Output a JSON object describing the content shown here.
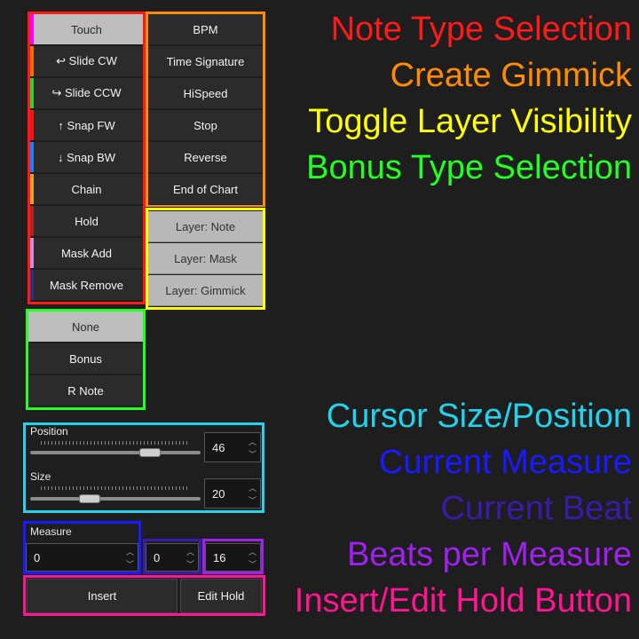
{
  "note_types": [
    {
      "label": "Touch",
      "stripe": "#ff00ff",
      "selected": true
    },
    {
      "label": "↩ Slide CW",
      "stripe": "#ff6a00",
      "selected": false
    },
    {
      "label": "↪ Slide CCW",
      "stripe": "#2fd12f",
      "selected": false
    },
    {
      "label": "↑ Snap FW",
      "stripe": "#ff1111",
      "selected": false
    },
    {
      "label": "↓ Snap BW",
      "stripe": "#1e7fff",
      "selected": false
    },
    {
      "label": "Chain",
      "stripe": "#e8a020",
      "selected": false
    },
    {
      "label": "Hold",
      "stripe": "#b22222",
      "selected": false
    },
    {
      "label": "Mask Add",
      "stripe": "#d08ad8",
      "selected": false
    },
    {
      "label": "Mask Remove",
      "stripe": "#3a2a7a",
      "selected": false
    }
  ],
  "gimmicks": [
    "BPM",
    "Time Signature",
    "HiSpeed",
    "Stop",
    "Reverse",
    "End of Chart"
  ],
  "layers": [
    "Layer: Note",
    "Layer: Mask",
    "Layer: Gimmick"
  ],
  "bonus_types": [
    {
      "label": "None",
      "selected": true
    },
    {
      "label": "Bonus",
      "selected": false
    },
    {
      "label": "R Note",
      "selected": false
    }
  ],
  "cursor": {
    "position_label": "Position",
    "position_value": "46",
    "position_fraction": 0.73,
    "size_label": "Size",
    "size_value": "20",
    "size_fraction": 0.33
  },
  "measure": {
    "label": "Measure",
    "value": "0"
  },
  "beat": {
    "value": "0"
  },
  "beats_per_measure": {
    "value": "16"
  },
  "actions": {
    "insert": "Insert",
    "edit_hold": "Edit Hold"
  },
  "annotations": [
    {
      "text": "Note Type Selection",
      "color": "#ff1a1a"
    },
    {
      "text": "Create Gimmick",
      "color": "#ff8c00"
    },
    {
      "text": "Toggle Layer Visibility",
      "color": "#ffff00"
    },
    {
      "text": "Bonus Type Selection",
      "color": "#22ff22"
    },
    {
      "text": "Cursor Size/Position",
      "color": "#22d3ee"
    },
    {
      "text": "Current Measure",
      "color": "#1a1aff"
    },
    {
      "text": "Current Beat",
      "color": "#3a1aa8"
    },
    {
      "text": "Beats per Measure",
      "color": "#a020f0"
    },
    {
      "text": "Insert/Edit Hold Button",
      "color": "#ff1493"
    }
  ]
}
